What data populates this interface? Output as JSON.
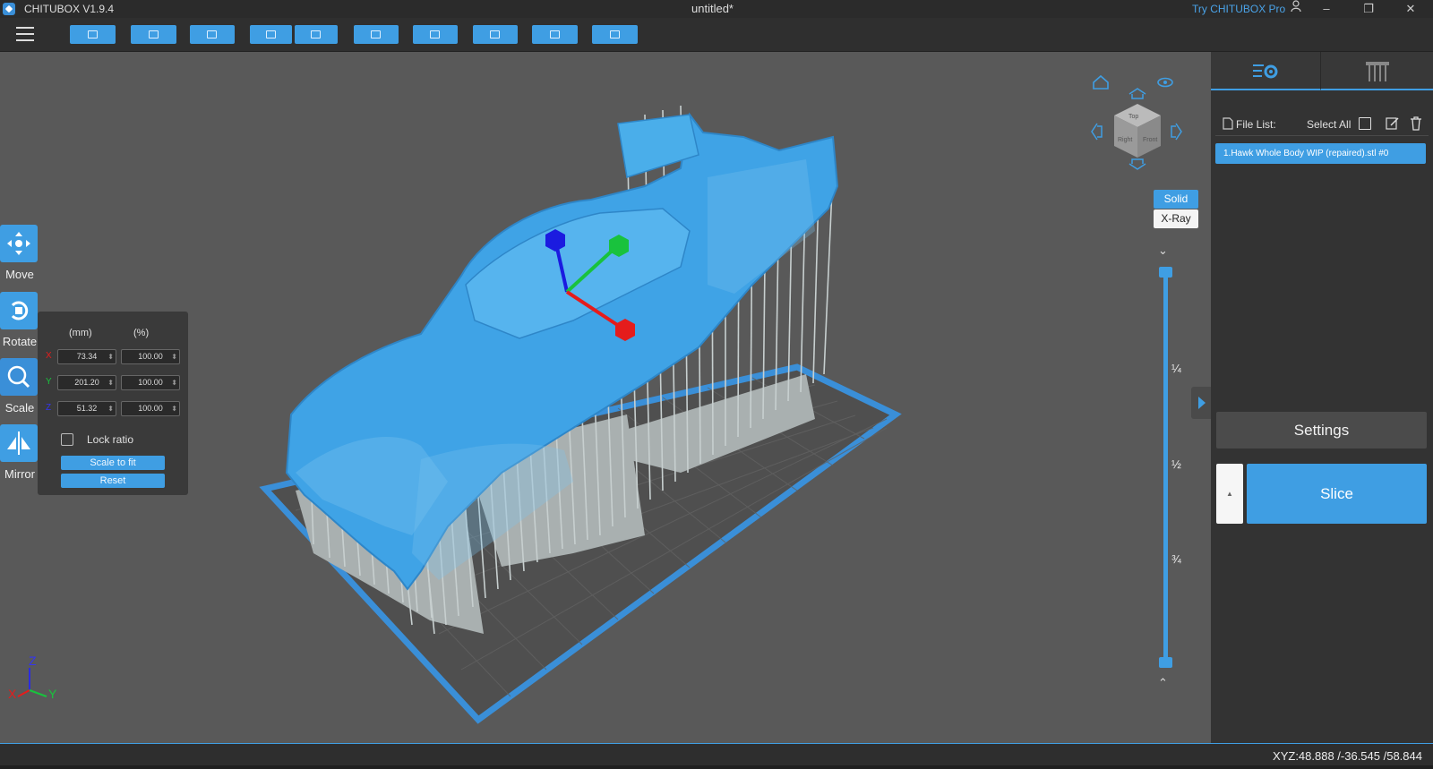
{
  "titlebar": {
    "app_name": "CHITUBOX V1.9.4",
    "document": "untitled*",
    "try_pro": "Try CHITUBOX Pro"
  },
  "toolbar": {
    "icons": [
      "menu-icon",
      "open-file-icon",
      "save-icon",
      "auto-layout-icon",
      "undo-icon",
      "redo-icon",
      "document-icon",
      "supports-icon",
      "hollow-icon",
      "center-icon",
      "clear-icon"
    ]
  },
  "tools": {
    "move": "Move",
    "rotate": "Rotate",
    "scale": "Scale",
    "mirror": "Mirror"
  },
  "scale_panel": {
    "unit_mm": "(mm)",
    "unit_pct": "(%)",
    "x_label": "X",
    "y_label": "Y",
    "z_label": "Z",
    "x_mm": "73.34",
    "y_mm": "201.20",
    "z_mm": "51.32",
    "x_pct": "100.00",
    "y_pct": "100.00",
    "z_pct": "100.00",
    "lock_ratio": "Lock ratio",
    "scale_to_fit": "Scale to fit",
    "reset": "Reset"
  },
  "view": {
    "solid": "Solid",
    "xray": "X-Ray",
    "cube_faces": [
      "Top",
      "Right",
      "Front"
    ]
  },
  "layer_slider": {
    "marks": [
      "¼",
      "½",
      "¾"
    ]
  },
  "axis_gizmo": {
    "x": "X",
    "y": "Y",
    "z": "Z"
  },
  "right_panel": {
    "file_list_label": "File List:",
    "select_all_label": "Select All",
    "file_item": "1.Hawk Whole Body WIP (repaired).stl #0",
    "settings": "Settings",
    "slice": "Slice"
  },
  "status": {
    "coords": "XYZ:48.888 /-36.545 /58.844"
  },
  "colors": {
    "accent": "#3f9ee3",
    "model": "#3fa3e6",
    "support": "#c7cfcf",
    "plate_border": "#3a8fd8",
    "axis_x": "#e51c1c",
    "axis_y": "#19c23d",
    "axis_z": "#1b1be0"
  }
}
